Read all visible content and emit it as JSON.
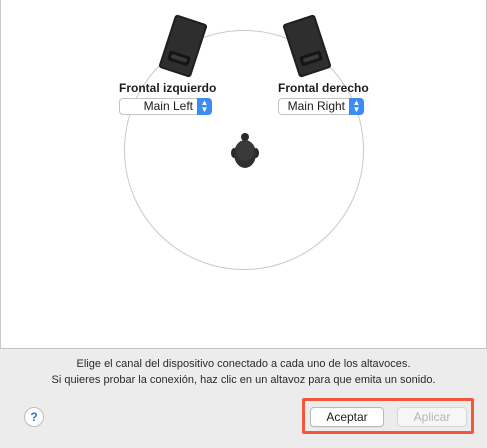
{
  "speakers": {
    "front_left": {
      "label": "Frontal izquierdo",
      "channel": "Main Left",
      "icon": "speaker-icon"
    },
    "front_right": {
      "label": "Frontal derecho",
      "channel": "Main Right",
      "icon": "speaker-icon"
    }
  },
  "listener_icon": "listener-head-icon",
  "stepper_glyphs": {
    "up": "▲",
    "down": "▼"
  },
  "info": {
    "line1": "Elige el canal del dispositivo conectado a cada uno de los altavoces.",
    "line2": "Si quieres probar la conexión, haz clic en un altavoz para que emita un sonido."
  },
  "footer": {
    "help_label": "?",
    "ok_label": "Aceptar",
    "apply_label": "Aplicar",
    "apply_enabled": false
  },
  "colors": {
    "accent": "#3b8cf4",
    "highlight": "#ef5a3c",
    "panel_bg": "#ffffff",
    "window_bg": "#ececec"
  }
}
